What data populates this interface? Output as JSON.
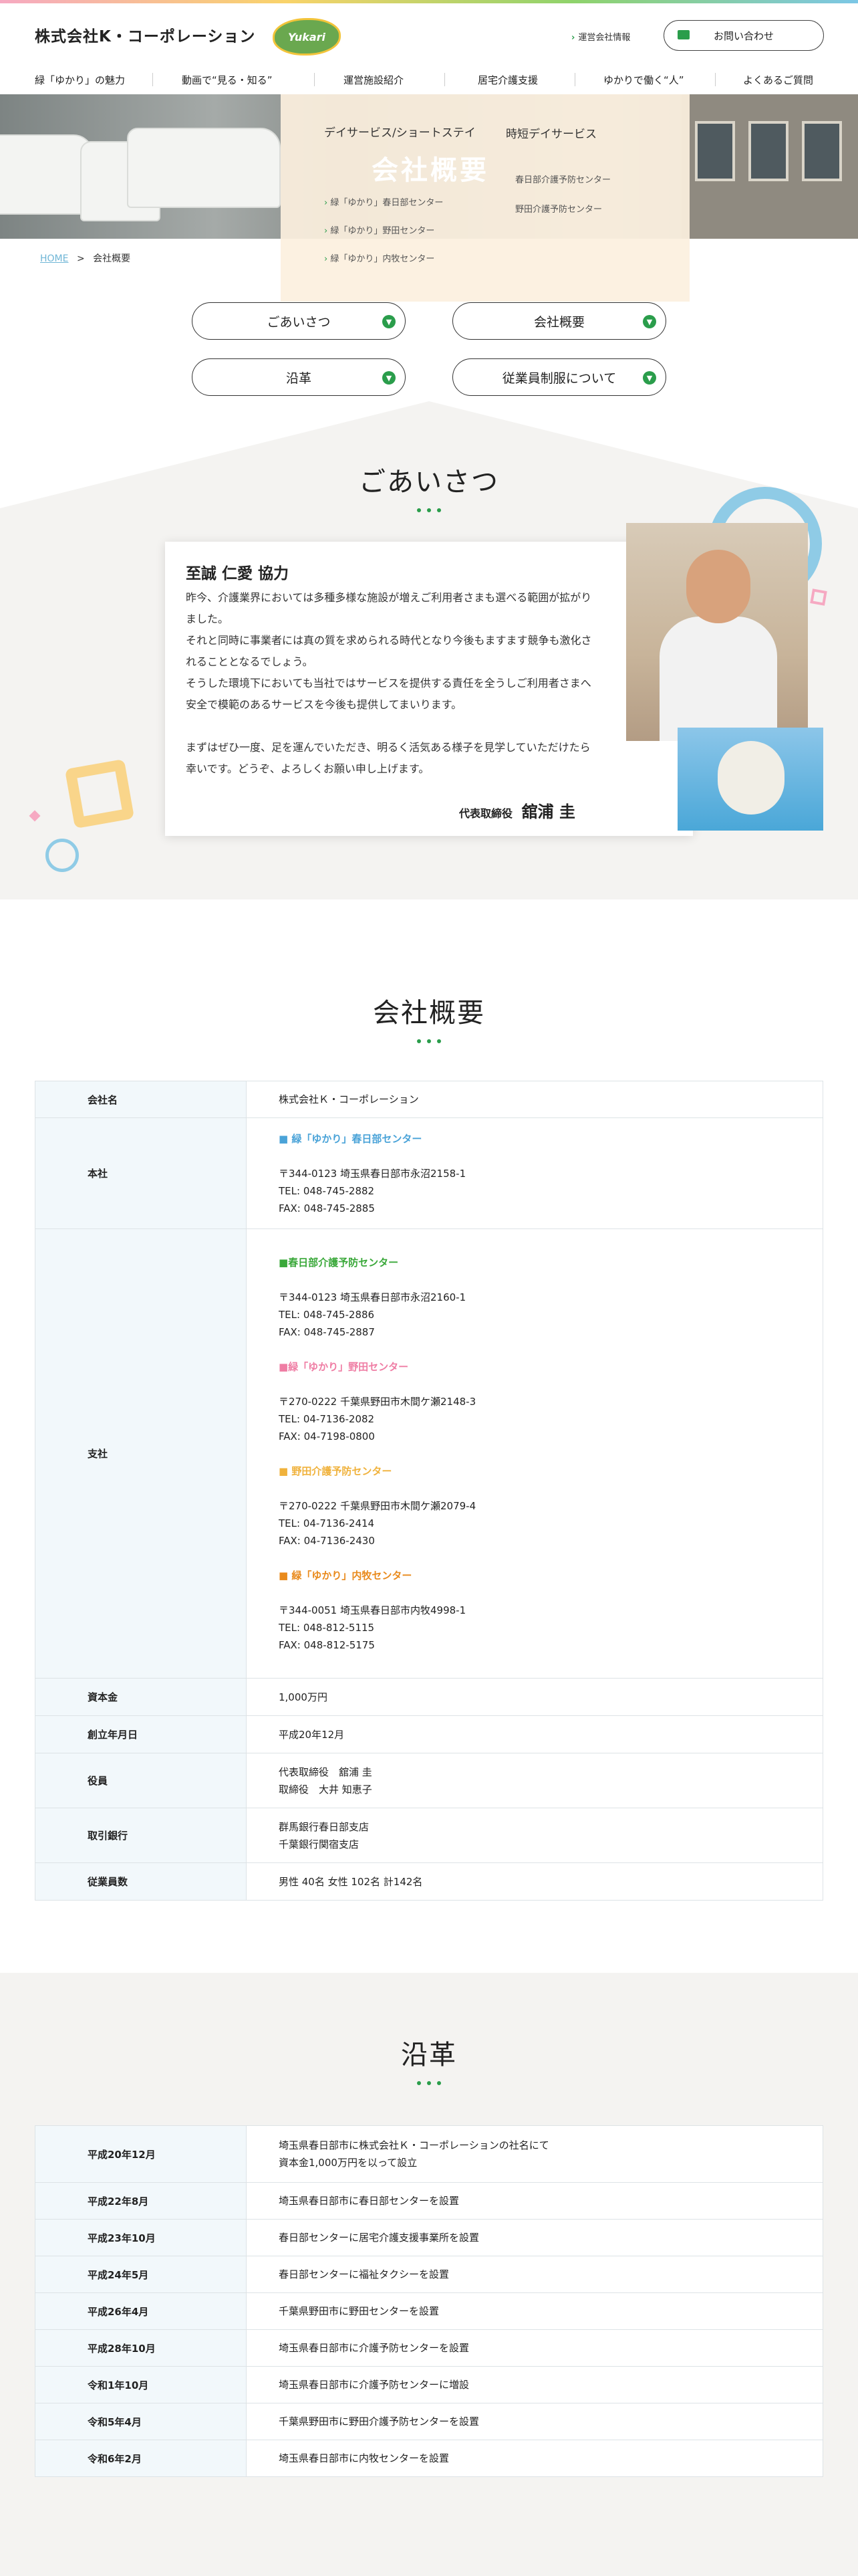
{
  "header": {
    "company": "株式会社K・コーポレーション",
    "logo_text": "Yukari",
    "operator_link": "運営会社情報",
    "contact_button": "お問い合わせ"
  },
  "nav": [
    "緑「ゆかり」の魅力",
    "動画で“見る・知る”",
    "運営施設紹介",
    "居宅介護支援",
    "ゆかりで働く“人”",
    "よくあるご質問"
  ],
  "hero": {
    "menu_left": "デイサービス/ショートステイ",
    "menu_right": "時短デイサービス",
    "title": "会社概要",
    "item1": "緑「ゆかり」春日部センター",
    "item2": "緑「ゆかり」野田センター",
    "item3": "緑「ゆかり」内牧センター",
    "item4": "春日部介護予防センター",
    "item5": "野田介護予防センター"
  },
  "breadcrumb": {
    "home": "HOME",
    "sep": ">",
    "current": "会社概要"
  },
  "pills": [
    "ごあいさつ",
    "会社概要",
    "沿革",
    "従業員制服について"
  ],
  "greeting": {
    "title": "ごあいさつ",
    "heading": "至誠 仁愛 協力",
    "p1": "昨今、介護業界においては多種多様な施設が増えご利用者さまも選べる範囲が拡がりました。",
    "p2": "それと同時に事業者には真の質を求められる時代となり今後もますます競争も激化されることとなるでしょう。",
    "p3": "そうした環境下においても当社ではサービスを提供する責任を全うしご利用者さまへ安全で模範のあるサービスを今後も提供してまいります。",
    "p4": "まずはぜひ一度、足を運んでいただき、明るく活気ある様子を見学していただけたら幸いです。どうぞ、よろしくお願い申し上げます。",
    "sign_title": "代表取締役",
    "sign_name": "舘浦 圭"
  },
  "company": {
    "title": "会社概要",
    "name_th": "会社名",
    "name_td": "株式会社Ｋ・コーポレーション",
    "hq_th": "本社",
    "hq_label": "■ 緑「ゆかり」春日部センター",
    "hq_addr": "〒344-0123 埼玉県春日部市永沼2158-1",
    "hq_tel": "TEL: 048-745-2882",
    "hq_fax": "FAX: 048-745-2885",
    "branch_th": "支社",
    "b1_label": "■春日部介護予防センター",
    "b1_addr": "〒344-0123 埼玉県春日部市永沼2160-1",
    "b1_tel": "TEL: 048-745-2886",
    "b1_fax": "FAX: 048-745-2887",
    "b2_label": "■緑「ゆかり」野田センター",
    "b2_addr": "〒270-0222 千葉県野田市木間ケ瀬2148-3",
    "b2_tel": "TEL: 04-7136-2082",
    "b2_fax": "FAX: 04-7198-0800",
    "b3_label": "■ 野田介護予防センター",
    "b3_addr": "〒270-0222 千葉県野田市木間ケ瀬2079-4",
    "b3_tel": "TEL: 04-7136-2414",
    "b3_fax": "FAX: 04-7136-2430",
    "b4_label": "■ 緑「ゆかり」内牧センター",
    "b4_addr": "〒344-0051 埼玉県春日部市内牧4998-1",
    "b4_tel": "TEL: 048-812-5115",
    "b4_fax": "FAX: 048-812-5175",
    "capital_th": "資本金",
    "capital_td": "1,000万円",
    "founded_th": "創立年月日",
    "founded_td": "平成20年12月",
    "officer_th": "役員",
    "officer_1": "代表取締役　舘浦 圭",
    "officer_2": "取締役　大井 知恵子",
    "bank_th": "取引銀行",
    "bank_1": "群馬銀行春日部支店",
    "bank_2": "千葉銀行関宿支店",
    "staff_th": "従業員数",
    "staff_td": "男性 40名 女性 102名 計142名"
  },
  "history": {
    "title": "沿革",
    "rows": [
      {
        "date": "平成20年12月",
        "text": "埼玉県春日部市に株式会社Ｋ・コーポレーションの社名にて",
        "text2": "資本金1,000万円を以って設立"
      },
      {
        "date": "平成22年8月",
        "text": "埼玉県春日部市に春日部センターを設置"
      },
      {
        "date": "平成23年10月",
        "text": "春日部センターに居宅介護支援事業所を設置"
      },
      {
        "date": "平成24年5月",
        "text": "春日部センターに福祉タクシーを設置"
      },
      {
        "date": "平成26年4月",
        "text": "千葉県野田市に野田センターを設置"
      },
      {
        "date": "平成28年10月",
        "text": "埼玉県春日部市に介護予防センターを設置"
      },
      {
        "date": "令和1年10月",
        "text": "埼玉県春日部市に介護予防センターに増設"
      },
      {
        "date": "令和5年4月",
        "text": "千葉県野田市に野田介護予防センターを設置"
      },
      {
        "date": "令和6年2月",
        "text": "埼玉県春日部市に内牧センターを設置"
      }
    ]
  },
  "colors": {
    "accent": "#2a9d4b",
    "table_head": "#f2f8fb",
    "blue": "#4aa3d8"
  }
}
